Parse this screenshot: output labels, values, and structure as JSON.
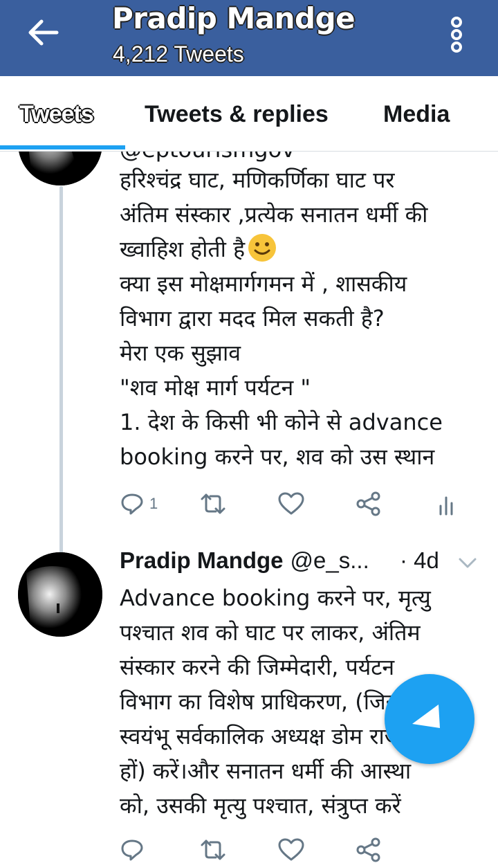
{
  "header": {
    "title": "Pradip Mandge",
    "tweet_count": "4,212 Tweets",
    "bg_color": "#3a5f9e"
  },
  "tabs": [
    {
      "label": "Tweets",
      "active": true
    },
    {
      "label": "Tweets & replies",
      "active": false
    },
    {
      "label": "Media",
      "active": false
    }
  ],
  "tweet1": {
    "cut_handle": "@eptourismgov",
    "lines": [
      "हरिश्चंद्र घाट, मणिकर्णिका घाट पर",
      "अंतिम संस्कार ,प्रत्येक सनातन धर्मी की",
      "ख्वाहिश होती है",
      "क्या इस मोक्षमार्गगमन में , शासकीय",
      "विभाग द्वारा मदद मिल सकती है?",
      "मेरा एक सुझाव",
      "\"शव मोक्ष मार्ग पर्यटन \"",
      "1. देश के किसी भी कोने से advance",
      "booking करने पर, शव को उस स्थान"
    ],
    "reply_count": "1"
  },
  "tweet2": {
    "name": "Pradip Mandge",
    "handle": "@e_s...",
    "time": "· 4d",
    "lines": [
      "Advance booking करने पर, मृत्यु",
      "पश्चात शव को घाट पर लाकर, अंतिम",
      "संस्कार करने की जिम्मेदारी, पर्यटन",
      "विभाग का विशेष प्राधिकरण, (जिसके",
      "स्वयंभू सर्वकालिक अध्यक्ष डोम राजा",
      "हों) करें।और सनातन धर्मी की आस्था",
      "को, उसकी मृत्यु पश्चात, संत्रुप्त करें"
    ]
  },
  "icons": {
    "back": "arrow-left-icon",
    "more": "more-vertical-icon",
    "reply": "reply-icon",
    "retweet": "retweet-icon",
    "like": "heart-icon",
    "share": "share-icon",
    "analytics": "analytics-icon",
    "compose": "compose-icon"
  },
  "colors": {
    "accent": "#1da1f2",
    "icon_gray": "#657786"
  }
}
